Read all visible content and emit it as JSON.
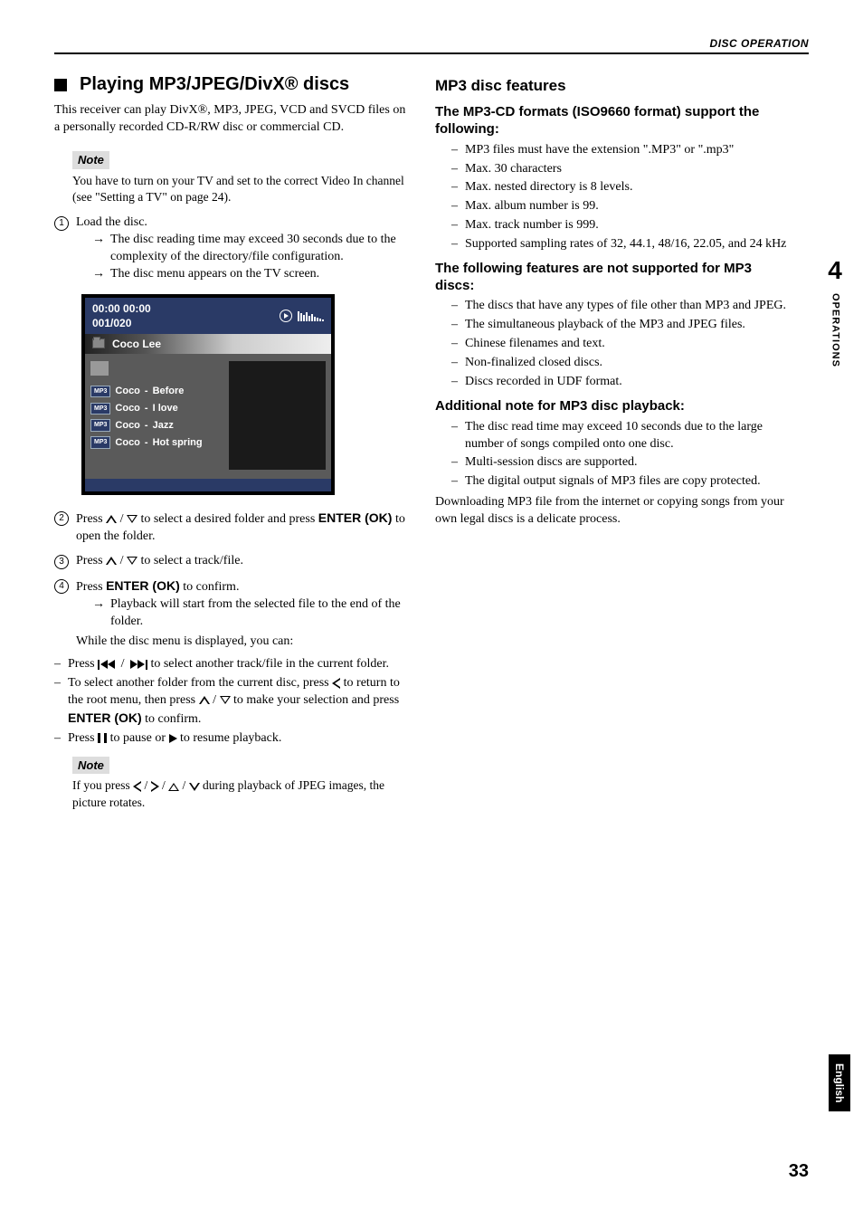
{
  "header": {
    "section": "DISC OPERATION"
  },
  "sidebar": {
    "chapter_num": "4",
    "chapter_label": "OPERATIONS"
  },
  "footer": {
    "language": "English",
    "page": "33"
  },
  "left": {
    "heading": "Playing MP3/JPEG/DivX® discs",
    "intro": "This receiver can play DivX®, MP3, JPEG, VCD and SVCD files on a personally recorded CD-R/RW disc or commercial CD.",
    "note1_label": "Note",
    "note1_body": "You have to turn on your TV and set to the correct Video In channel (see \"Setting a TV\" on page 24).",
    "step1": "Load the disc.",
    "step1_a": "The disc reading time may exceed 30 seconds due to the complexity of the directory/file configuration.",
    "step1_b": "The disc menu appears on the TV screen.",
    "disc_menu": {
      "time": "00:00   00:00",
      "counter": "001/020",
      "title": "Coco Lee",
      "tracks": [
        {
          "tag": "MP3",
          "artist": "Coco",
          "sep": "-",
          "title": "Before"
        },
        {
          "tag": "MP3",
          "artist": "Coco",
          "sep": "-",
          "title": "I love"
        },
        {
          "tag": "MP3",
          "artist": "Coco",
          "sep": "-",
          "title": "Jazz"
        },
        {
          "tag": "MP3",
          "artist": "Coco",
          "sep": "-",
          "title": "Hot spring"
        }
      ]
    },
    "step2_a": "Press ",
    "step2_b": " to select a desired folder and press ",
    "step2_c": " to open the folder.",
    "enter_ok": "ENTER (OK)",
    "step3_a": "Press ",
    "step3_b": " to select a track/file.",
    "step4_a": "Press ",
    "step4_b": " to confirm.",
    "step4_arrow": "Playback will start from the selected file to the end of the folder.",
    "step4_while": "While the disc menu is displayed, you can:",
    "bullet_a1": "Press ",
    "bullet_a2": " to select another track/file in the current folder.",
    "bullet_b1": "To select another folder from the current disc, press ",
    "bullet_b2": " to return to the root menu, then press ",
    "bullet_b3": " to make your selection and press ",
    "bullet_b4": " to confirm.",
    "bullet_c1": "Press ",
    "bullet_c2": " to pause or ",
    "bullet_c3": " to resume playback.",
    "note2_label": "Note",
    "note2_a": "If you press ",
    "note2_b": " during playback of JPEG images, the picture rotates.",
    "slash": " / "
  },
  "right": {
    "h2": "MP3 disc features",
    "h3a": "The MP3-CD formats (ISO9660 format) support the following:",
    "list_a": [
      "MP3 files must have the extension \".MP3\" or \".mp3\"",
      "Max. 30 characters",
      "Max. nested directory is 8 levels.",
      "Max. album number is 99.",
      "Max. track number is 999.",
      "Supported sampling rates of 32, 44.1, 48/16, 22.05, and 24 kHz"
    ],
    "h3b": "The following features are not supported for MP3 discs:",
    "list_b": [
      "The discs that have any types of file other than MP3 and JPEG.",
      "The simultaneous playback of the MP3 and JPEG files.",
      "Chinese filenames and text.",
      "Non-finalized closed discs.",
      "Discs recorded in UDF format."
    ],
    "h3c": "Additional note for MP3 disc playback:",
    "list_c": [
      "The disc read time may exceed 10 seconds due to the large number of songs compiled onto one disc.",
      "Multi-session discs are supported.",
      "The digital output signals of MP3 files are copy protected."
    ],
    "closing": "Downloading MP3 file from the internet or copying songs from your own legal discs is a delicate process."
  }
}
